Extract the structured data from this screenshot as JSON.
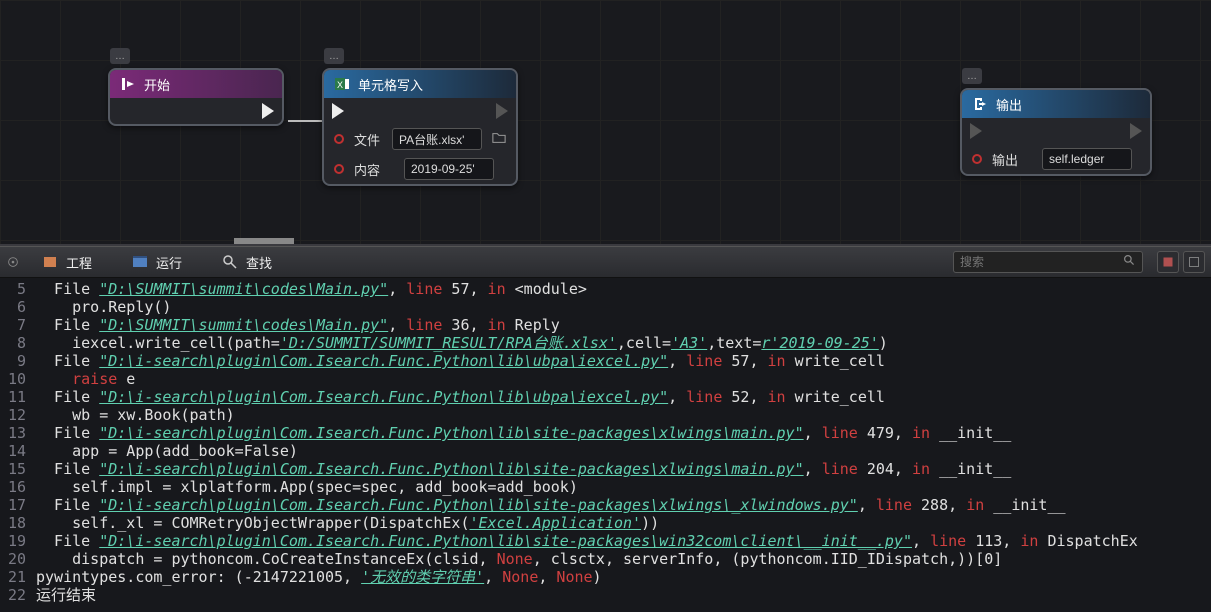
{
  "nodes": {
    "start": {
      "title": "开始",
      "tag": "…"
    },
    "excel": {
      "title": "单元格写入",
      "tag": "…",
      "params": {
        "file_label": "文件",
        "file_value": "PA台账.xlsx'",
        "content_label": "内容",
        "content_value": "2019-09-25'"
      }
    },
    "output": {
      "title": "输出",
      "tag": "…",
      "params": {
        "out_label": "输出",
        "out_value": "self.ledger"
      }
    }
  },
  "tabs": {
    "project": "工程",
    "run": "运行",
    "find": "查找"
  },
  "search_placeholder": "搜索",
  "console": [
    {
      "n": 5,
      "parts": [
        [
          "w",
          "  File "
        ],
        [
          "path",
          "\"D:\\SUMMIT\\summit\\codes\\Main.py\""
        ],
        [
          "w",
          ", "
        ],
        [
          "red",
          "line"
        ],
        [
          "w",
          " 57, "
        ],
        [
          "red",
          "in"
        ],
        [
          "w",
          " <module>"
        ]
      ]
    },
    {
      "n": 6,
      "parts": [
        [
          "w",
          "    pro.Reply()"
        ]
      ]
    },
    {
      "n": 7,
      "parts": [
        [
          "w",
          "  File "
        ],
        [
          "path",
          "\"D:\\SUMMIT\\summit\\codes\\Main.py\""
        ],
        [
          "w",
          ", "
        ],
        [
          "red",
          "line"
        ],
        [
          "w",
          " 36, "
        ],
        [
          "red",
          "in"
        ],
        [
          "w",
          " Reply"
        ]
      ]
    },
    {
      "n": 8,
      "parts": [
        [
          "w",
          "    iexcel.write_cell(path="
        ],
        [
          "str",
          "'D:/SUMMIT/SUMMIT_RESULT/RPA台账.xlsx'"
        ],
        [
          "w",
          ",cell="
        ],
        [
          "str",
          "'A3'"
        ],
        [
          "w",
          ",text="
        ],
        [
          "str",
          "r'2019-09-25'"
        ],
        [
          "w",
          ")"
        ]
      ]
    },
    {
      "n": 9,
      "parts": [
        [
          "w",
          "  File "
        ],
        [
          "path",
          "\"D:\\i-search\\plugin\\Com.Isearch.Func.Python\\lib\\ubpa\\iexcel.py\""
        ],
        [
          "w",
          ", "
        ],
        [
          "red",
          "line"
        ],
        [
          "w",
          " 57, "
        ],
        [
          "red",
          "in"
        ],
        [
          "w",
          " write_cell"
        ]
      ]
    },
    {
      "n": 10,
      "parts": [
        [
          "red",
          "    raise"
        ],
        [
          "w",
          " e"
        ]
      ]
    },
    {
      "n": 11,
      "parts": [
        [
          "w",
          "  File "
        ],
        [
          "path",
          "\"D:\\i-search\\plugin\\Com.Isearch.Func.Python\\lib\\ubpa\\iexcel.py\""
        ],
        [
          "w",
          ", "
        ],
        [
          "red",
          "line"
        ],
        [
          "w",
          " 52, "
        ],
        [
          "red",
          "in"
        ],
        [
          "w",
          " write_cell"
        ]
      ]
    },
    {
      "n": 12,
      "parts": [
        [
          "w",
          "    wb = xw.Book(path)"
        ]
      ]
    },
    {
      "n": 13,
      "parts": [
        [
          "w",
          "  File "
        ],
        [
          "path",
          "\"D:\\i-search\\plugin\\Com.Isearch.Func.Python\\lib\\site-packages\\xlwings\\main.py\""
        ],
        [
          "w",
          ", "
        ],
        [
          "red",
          "line"
        ],
        [
          "w",
          " 479, "
        ],
        [
          "red",
          "in"
        ],
        [
          "w",
          " __init__"
        ]
      ]
    },
    {
      "n": 14,
      "parts": [
        [
          "w",
          "    app = App(add_book=False)"
        ]
      ]
    },
    {
      "n": 15,
      "parts": [
        [
          "w",
          "  File "
        ],
        [
          "path",
          "\"D:\\i-search\\plugin\\Com.Isearch.Func.Python\\lib\\site-packages\\xlwings\\main.py\""
        ],
        [
          "w",
          ", "
        ],
        [
          "red",
          "line"
        ],
        [
          "w",
          " 204, "
        ],
        [
          "red",
          "in"
        ],
        [
          "w",
          " __init__"
        ]
      ]
    },
    {
      "n": 16,
      "parts": [
        [
          "w",
          "    self.impl = xlplatform.App(spec=spec, add_book=add_book)"
        ]
      ]
    },
    {
      "n": 17,
      "parts": [
        [
          "w",
          "  File "
        ],
        [
          "path",
          "\"D:\\i-search\\plugin\\Com.Isearch.Func.Python\\lib\\site-packages\\xlwings\\_xlwindows.py\""
        ],
        [
          "w",
          ", "
        ],
        [
          "red",
          "line"
        ],
        [
          "w",
          " 288, "
        ],
        [
          "red",
          "in"
        ],
        [
          "w",
          " __init__"
        ]
      ]
    },
    {
      "n": 18,
      "parts": [
        [
          "w",
          "    self._xl = COMRetryObjectWrapper(DispatchEx("
        ],
        [
          "str",
          "'Excel.Application'"
        ],
        [
          "w",
          "))"
        ]
      ]
    },
    {
      "n": 19,
      "parts": [
        [
          "w",
          "  File "
        ],
        [
          "path",
          "\"D:\\i-search\\plugin\\Com.Isearch.Func.Python\\lib\\site-packages\\win32com\\client\\__init__.py\""
        ],
        [
          "w",
          ", "
        ],
        [
          "red",
          "line"
        ],
        [
          "w",
          " 113, "
        ],
        [
          "red",
          "in"
        ],
        [
          "w",
          " DispatchEx"
        ]
      ]
    },
    {
      "n": 20,
      "parts": [
        [
          "w",
          "    dispatch = pythoncom.CoCreateInstanceEx(clsid, "
        ],
        [
          "red",
          "None"
        ],
        [
          "w",
          ", clsctx, serverInfo, (pythoncom.IID_IDispatch,))[0]"
        ]
      ]
    },
    {
      "n": 21,
      "parts": [
        [
          "w",
          "pywintypes.com_error: (-2147221005, "
        ],
        [
          "str",
          "'无效的类字符串'"
        ],
        [
          "w",
          ", "
        ],
        [
          "red",
          "None"
        ],
        [
          "w",
          ", "
        ],
        [
          "red",
          "None"
        ],
        [
          "w",
          ")"
        ]
      ]
    },
    {
      "n": 22,
      "parts": [
        [
          "w",
          "运行结束"
        ]
      ]
    }
  ]
}
